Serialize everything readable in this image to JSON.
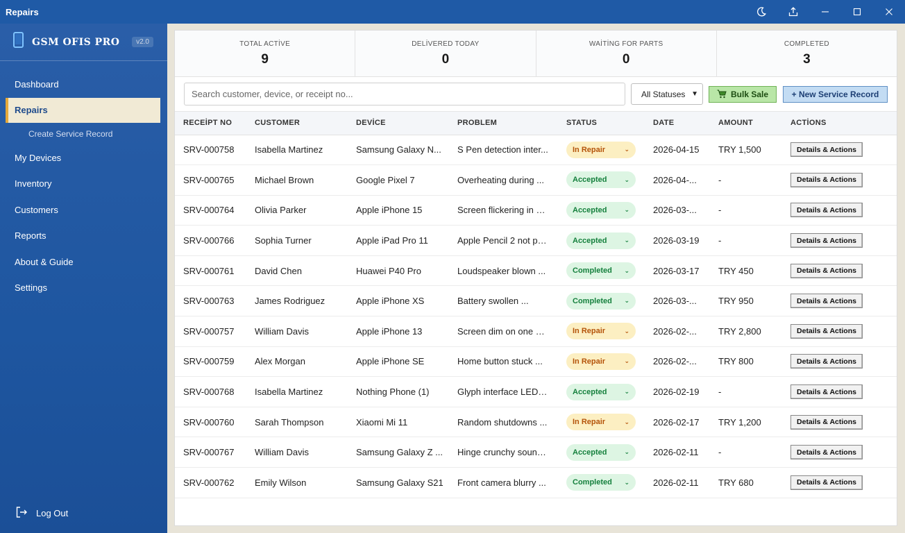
{
  "window": {
    "title": "Repairs"
  },
  "brand": {
    "name": "GSM OFIS PRO",
    "version": "v2.0"
  },
  "sidebar": {
    "items": [
      {
        "label": "Dashboard",
        "active": false
      },
      {
        "label": "Repairs",
        "active": true
      },
      {
        "label": "Create Service Record",
        "sub": true
      },
      {
        "label": "My Devices",
        "active": false
      },
      {
        "label": "Inventory",
        "active": false
      },
      {
        "label": "Customers",
        "active": false
      },
      {
        "label": "Reports",
        "active": false
      },
      {
        "label": "About & Guide",
        "active": false
      },
      {
        "label": "Settings",
        "active": false
      }
    ],
    "logout": "Log Out"
  },
  "stats": [
    {
      "label": "TOTAL ACTİVE",
      "value": "9"
    },
    {
      "label": "DELİVERED TODAY",
      "value": "0"
    },
    {
      "label": "WAİTİNG FOR PARTS",
      "value": "0"
    },
    {
      "label": "COMPLETED",
      "value": "3"
    }
  ],
  "toolbar": {
    "search_placeholder": "Search customer, device, or receipt no...",
    "status_filter": "All Statuses",
    "bulk_sale": "Bulk Sale",
    "new_record": "+ New Service Record"
  },
  "table": {
    "headers": [
      "RECEİPT NO",
      "CUSTOMER",
      "DEVİCE",
      "PROBLEM",
      "STATUS",
      "DATE",
      "AMOUNT",
      "ACTİONS"
    ],
    "action_label": "Details & Actions",
    "rows": [
      {
        "receipt": "SRV-000758",
        "customer": "Isabella Martinez",
        "device": "Samsung Galaxy N...",
        "problem": "S Pen detection inter...",
        "status": "In Repair",
        "date": "2026-04-15",
        "amount": "TRY 1,500"
      },
      {
        "receipt": "SRV-000765",
        "customer": "Michael Brown",
        "device": "Google Pixel 7",
        "problem": "Overheating during ...",
        "status": "Accepted",
        "date": "2026-04-...",
        "amount": "-"
      },
      {
        "receipt": "SRV-000764",
        "customer": "Olivia Parker",
        "device": "Apple iPhone 15",
        "problem": "Screen flickering in di...",
        "status": "Accepted",
        "date": "2026-03-...",
        "amount": "-"
      },
      {
        "receipt": "SRV-000766",
        "customer": "Sophia Turner",
        "device": "Apple iPad Pro 11",
        "problem": "Apple Pencil 2 not pa...",
        "status": "Accepted",
        "date": "2026-03-19",
        "amount": "-"
      },
      {
        "receipt": "SRV-000761",
        "customer": "David Chen",
        "device": "Huawei P40 Pro",
        "problem": "Loudspeaker blown ...",
        "status": "Completed",
        "date": "2026-03-17",
        "amount": "TRY 450"
      },
      {
        "receipt": "SRV-000763",
        "customer": "James Rodriguez",
        "device": "Apple iPhone XS",
        "problem": "Battery swollen ...",
        "status": "Completed",
        "date": "2026-03-...",
        "amount": "TRY 950"
      },
      {
        "receipt": "SRV-000757",
        "customer": "William Davis",
        "device": "Apple iPhone 13",
        "problem": "Screen dim on one si...",
        "status": "In Repair",
        "date": "2026-02-...",
        "amount": "TRY 2,800"
      },
      {
        "receipt": "SRV-000759",
        "customer": "Alex Morgan",
        "device": "Apple iPhone SE",
        "problem": "Home button stuck ...",
        "status": "In Repair",
        "date": "2026-02-...",
        "amount": "TRY 800"
      },
      {
        "receipt": "SRV-000768",
        "customer": "Isabella Martinez",
        "device": "Nothing Phone (1)",
        "problem": "Glyph interface LEDs...",
        "status": "Accepted",
        "date": "2026-02-19",
        "amount": "-"
      },
      {
        "receipt": "SRV-000760",
        "customer": "Sarah Thompson",
        "device": "Xiaomi Mi 11",
        "problem": "Random shutdowns ...",
        "status": "In Repair",
        "date": "2026-02-17",
        "amount": "TRY 1,200"
      },
      {
        "receipt": "SRV-000767",
        "customer": "William Davis",
        "device": "Samsung Galaxy Z ...",
        "problem": "Hinge crunchy sound ...",
        "status": "Accepted",
        "date": "2026-02-11",
        "amount": "-"
      },
      {
        "receipt": "SRV-000762",
        "customer": "Emily Wilson",
        "device": "Samsung Galaxy S21",
        "problem": "Front camera blurry ...",
        "status": "Completed",
        "date": "2026-02-11",
        "amount": "TRY 680"
      }
    ]
  }
}
